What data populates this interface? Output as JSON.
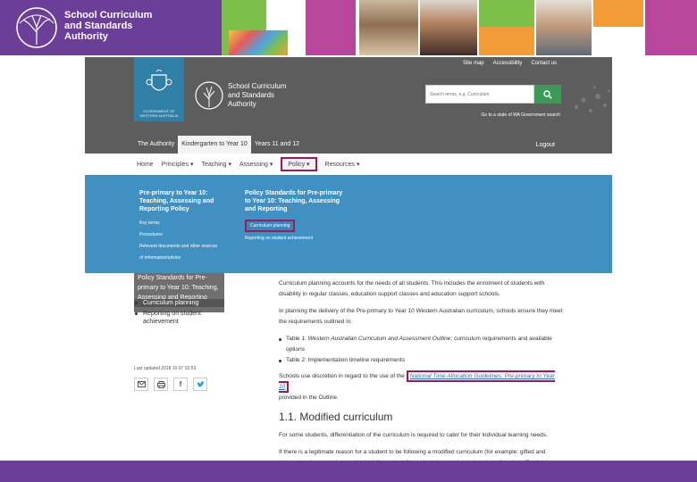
{
  "banner": {
    "org_line1": "School Curriculum",
    "org_line2": "and Standards",
    "org_line3": "Authority",
    "colors": {
      "purple": "#6b3f98",
      "green": "#7cc04a",
      "magenta": "#b8479c",
      "orange": "#f29c38"
    }
  },
  "site": {
    "top_links": [
      "Site map",
      "Accessibility",
      "Contact us"
    ],
    "crest_text": "GOVERNMENT OF WESTERN AUSTRALIA",
    "name_line1": "School Curriculum",
    "name_line2": "and Standards",
    "name_line3": "Authority",
    "search_placeholder": "Search terms, e.g. Curriculum",
    "gov_line": "Go to a state of WA Government search",
    "tabs": [
      "The Authority",
      "Kindergarten to Year 10",
      "Years 11 and 12"
    ],
    "logout": "Logout",
    "subnav": [
      "Home",
      "Principles",
      "Teaching",
      "Assessing",
      "Policy",
      "Resources"
    ],
    "mega": {
      "col1_head": "Pre-primary to Year 10: Teaching, Assessing and Reporting Policy",
      "col1_links": [
        "Key terms",
        "Procedures",
        "Relevant documents and other sources",
        "of information/advice"
      ],
      "col2_head": "Policy Standards for Pre-primary to Year 10: Teaching, Assessing and Reporting",
      "col2_links": [
        "Curriculum planning",
        "Reporting on student achievement"
      ]
    },
    "sidebar": {
      "box_text": "Policy Standards for Pre-primary to Year 10: Teaching, Assessing and Reporting",
      "items": [
        "Curriculum planning",
        "Reporting on student achievement"
      ],
      "updated": "Last updated 2018 10 07 02:53"
    },
    "content": {
      "p1": "Curriculum planning accounts for the needs of all students. This includes the enrolment of students with disability in regular classes, education support classes and education support schools.",
      "p2": "In planning the delivery of the Pre-primary to Year 10 Western Australian curriculum, schools ensure they meet the requirements outlined in:",
      "bullet1_italic": "Western Australian Curriculum and Assessment Outline",
      "bullet1_prefix": "Table 1: ",
      "bullet1_suffix": ": curriculum requirements and available options",
      "bullet2": "Table 2: Implementation timeline requirements",
      "p3_prefix": "Schools use discretion in regard to the use of the ",
      "p3_link": "National Time Allocation Guidelines: Pre-primary to Year 10",
      "p3_suffix_line": "provided in the Outline.",
      "h2": "1.1. Modified curriculum",
      "p4": "For some students, differentiation of the curriculum is required to cater for their individual learning needs.",
      "p5": "If there is a legitimate reason for a student to be following a modified curriculum (for example: gifted and talented students, students with disability and additional learning needs, and students for whom English is an"
    }
  }
}
